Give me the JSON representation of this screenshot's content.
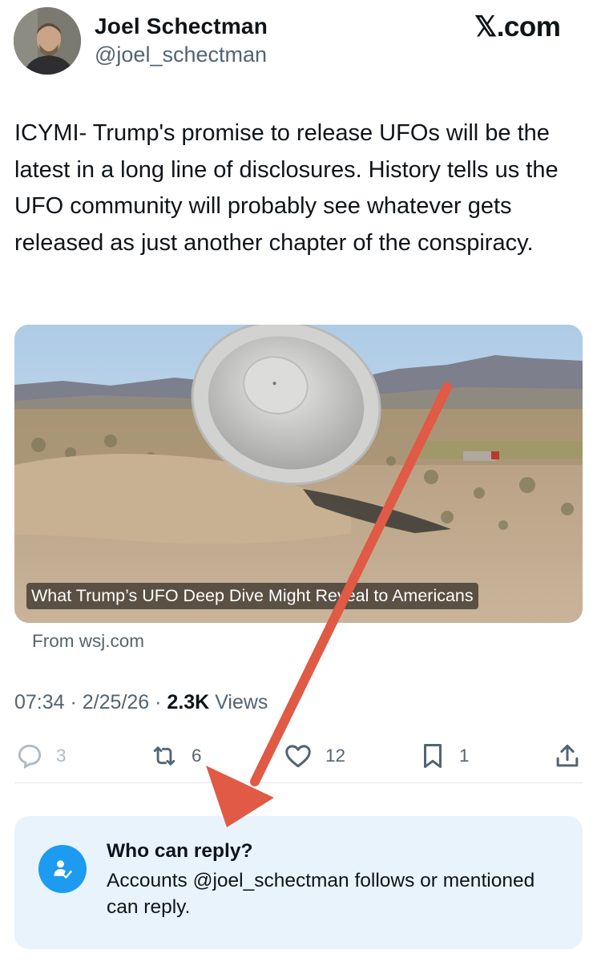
{
  "author": {
    "name": "Joel Schectman",
    "handle": "@joel_schectman"
  },
  "brand": "𝕏.com",
  "tweet": {
    "text": "ICYMI- Trump's promise to release UFOs will be the latest in a long line of disclosures. History tells us the UFO community will probably see whatever gets released as just another chapter of the conspiracy."
  },
  "card": {
    "title": "What Trump’s UFO Deep Dive Might Reveal to Americans",
    "source": "From wsj.com"
  },
  "meta": {
    "time": "07:34",
    "separator": " · ",
    "date": "2/25/26",
    "views_count": "2.3K",
    "views_label": "Views"
  },
  "actions": {
    "replies": "3",
    "reposts": "6",
    "likes": "12",
    "bookmarks": "1"
  },
  "reply_settings": {
    "heading": "Who can reply?",
    "description": "Accounts @joel_schectman follows or mentioned can reply."
  },
  "colors": {
    "accent": "#1d9bf0",
    "annotation_arrow": "#e05a45",
    "reply_box_bg": "#e8f3fc"
  }
}
